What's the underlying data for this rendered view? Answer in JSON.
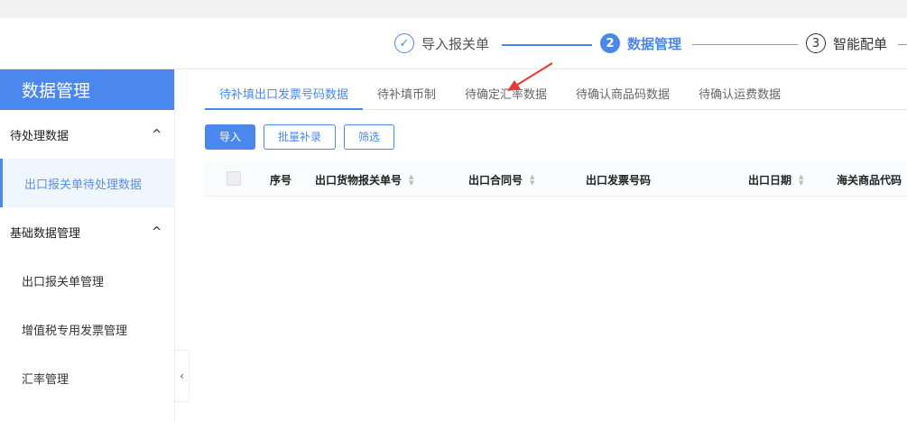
{
  "steps": [
    {
      "num": "✓",
      "label": "导入报关单"
    },
    {
      "num": "2",
      "label": "数据管理"
    },
    {
      "num": "3",
      "label": "智能配单"
    }
  ],
  "sidebar": {
    "title": "数据管理",
    "groups": [
      {
        "label": "待处理数据",
        "items": [
          {
            "label": "出口报关单待处理数据"
          }
        ]
      },
      {
        "label": "基础数据管理",
        "items": [
          {
            "label": "出口报关单管理"
          },
          {
            "label": "增值税专用发票管理"
          },
          {
            "label": "汇率管理"
          }
        ]
      }
    ]
  },
  "tabs": [
    {
      "label": "待补填出口发票号码数据"
    },
    {
      "label": "待补填币制"
    },
    {
      "label": "待确定汇率数据"
    },
    {
      "label": "待确认商品码数据"
    },
    {
      "label": "待确认运费数据"
    }
  ],
  "toolbar": {
    "import": "导入",
    "batch": "批量补录",
    "filter": "筛选"
  },
  "table": {
    "columns": [
      "序号",
      "出口货物报关单号",
      "出口合同号",
      "出口发票号码",
      "出口日期",
      "海关商品代码"
    ]
  },
  "colors": {
    "accent": "#4a88ee",
    "annotation": "#e53935"
  }
}
